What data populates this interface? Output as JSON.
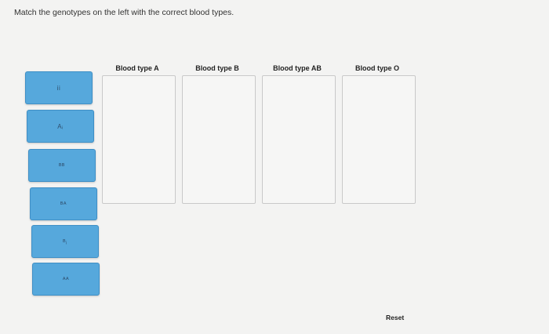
{
  "instruction": "Match the genotypes on the left with the correct blood types.",
  "genotypes": [
    {
      "label": "ii"
    },
    {
      "label": "Aᵢ"
    },
    {
      "label": "ᴮᴮ"
    },
    {
      "label": "ᴮᴬ"
    },
    {
      "label": "ᴮᵢ"
    },
    {
      "label": "ᴬᴬ"
    }
  ],
  "columns": [
    {
      "label": "Blood type A"
    },
    {
      "label": "Blood type B"
    },
    {
      "label": "Blood type AB"
    },
    {
      "label": "Blood type O"
    }
  ],
  "reset_label": "Reset",
  "colors": {
    "tile_fill": "#56a8dc",
    "tile_border": "#3f8fc6",
    "background": "#f3f3f2"
  }
}
